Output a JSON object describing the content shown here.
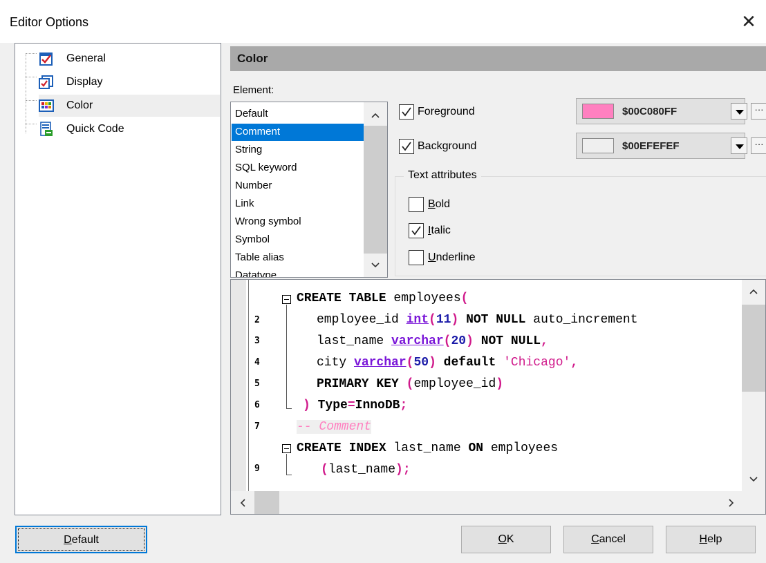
{
  "window": {
    "title": "Editor Options",
    "close_symbol": "✕"
  },
  "tree": {
    "items": [
      {
        "label": "General",
        "icon": "general-options-icon"
      },
      {
        "label": "Display",
        "icon": "display-options-icon"
      },
      {
        "label": "Color",
        "icon": "color-options-icon",
        "selected": true
      },
      {
        "label": "Quick Code",
        "icon": "quick-code-icon"
      }
    ]
  },
  "section": {
    "title": "Color"
  },
  "element": {
    "label": "Element:",
    "items": [
      "Default",
      "Comment",
      "String",
      "SQL keyword",
      "Number",
      "Link",
      "Wrong symbol",
      "Symbol",
      "Table alias",
      "Datatype"
    ],
    "selected": "Comment"
  },
  "foreground": {
    "label": "Foreground",
    "checked": true,
    "value": "$00C080FF",
    "swatch": "#ff80c0",
    "more": "···"
  },
  "background": {
    "label": "Background",
    "checked": true,
    "value": "$00EFEFEF",
    "swatch": "#efefef",
    "more": "···"
  },
  "text_attributes": {
    "title": "Text attributes",
    "bold": {
      "label_first": "B",
      "label_rest": "old",
      "checked": false
    },
    "italic": {
      "label_first": "I",
      "label_rest": "talic",
      "checked": true
    },
    "underline": {
      "label_first": "U",
      "label_rest": "nderline",
      "checked": false
    }
  },
  "editor": {
    "line_numbers": [
      "2",
      "3",
      "4",
      "5",
      "6",
      "7",
      "9"
    ],
    "lines": {
      "l1": {
        "kw1": "CREATE TABLE",
        "t1": " employees",
        "p1": "("
      },
      "l2": {
        "t1": "employee_id ",
        "ty": "int",
        "p1": "(",
        "n": "11",
        "p2": ")",
        "kw": " NOT NULL",
        "t2": " auto_increment"
      },
      "l3": {
        "t1": "last_name ",
        "ty": "varchar",
        "p1": "(",
        "n": "20",
        "p2": ")",
        "kw": " NOT NULL",
        "p3": ","
      },
      "l4": {
        "t1": "city ",
        "ty": "varchar",
        "p1": "(",
        "n": "50",
        "p2": ")",
        "t2": " default ",
        "s": "'Chicago'",
        "p3": ","
      },
      "l5": {
        "kw": "PRIMARY KEY",
        "t1": " ",
        "p1": "(",
        "t2": "employee_id",
        "p2": ")"
      },
      "l6": {
        "p1": ")",
        "kw": " Type",
        "p2": "=",
        "t1": "InnoDB",
        "p3": ";"
      },
      "l7": {
        "cm": "-- Comment"
      },
      "l8": {
        "kw1": "CREATE INDEX",
        "t1": " last_name ",
        "kw2": "ON",
        "t2": " employees"
      },
      "l9": {
        "p1": "(",
        "t1": "last_name",
        "p2": ");"
      }
    }
  },
  "buttons": {
    "default": {
      "first": "D",
      "rest": "efault"
    },
    "ok": {
      "first": "O",
      "rest": "K"
    },
    "cancel": {
      "first": "C",
      "rest": "ancel"
    },
    "help": {
      "first": "H",
      "rest": "elp"
    }
  }
}
